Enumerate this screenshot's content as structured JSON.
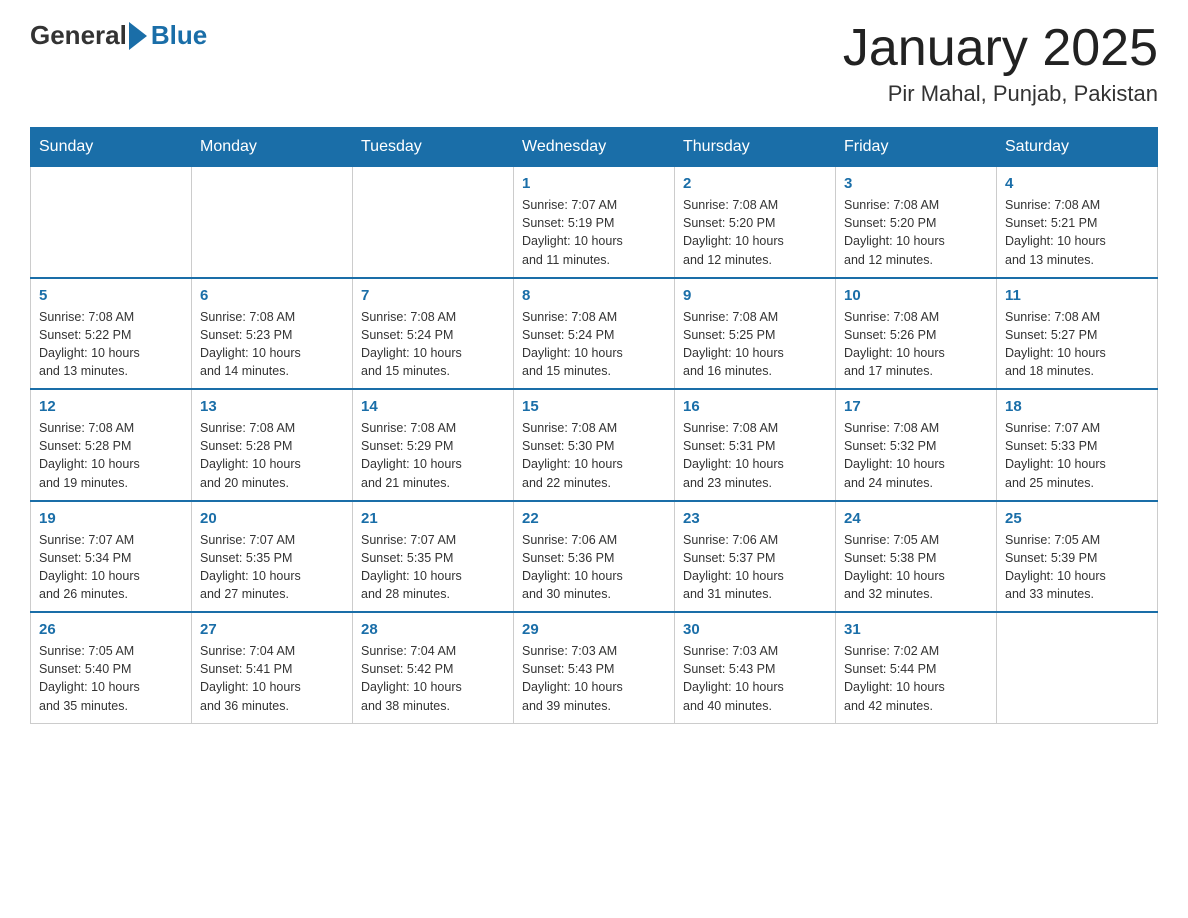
{
  "header": {
    "logo_general": "General",
    "logo_blue": "Blue",
    "title": "January 2025",
    "location": "Pir Mahal, Punjab, Pakistan"
  },
  "days_of_week": [
    "Sunday",
    "Monday",
    "Tuesday",
    "Wednesday",
    "Thursday",
    "Friday",
    "Saturday"
  ],
  "weeks": [
    {
      "days": [
        {
          "num": "",
          "info": ""
        },
        {
          "num": "",
          "info": ""
        },
        {
          "num": "",
          "info": ""
        },
        {
          "num": "1",
          "info": "Sunrise: 7:07 AM\nSunset: 5:19 PM\nDaylight: 10 hours\nand 11 minutes."
        },
        {
          "num": "2",
          "info": "Sunrise: 7:08 AM\nSunset: 5:20 PM\nDaylight: 10 hours\nand 12 minutes."
        },
        {
          "num": "3",
          "info": "Sunrise: 7:08 AM\nSunset: 5:20 PM\nDaylight: 10 hours\nand 12 minutes."
        },
        {
          "num": "4",
          "info": "Sunrise: 7:08 AM\nSunset: 5:21 PM\nDaylight: 10 hours\nand 13 minutes."
        }
      ]
    },
    {
      "days": [
        {
          "num": "5",
          "info": "Sunrise: 7:08 AM\nSunset: 5:22 PM\nDaylight: 10 hours\nand 13 minutes."
        },
        {
          "num": "6",
          "info": "Sunrise: 7:08 AM\nSunset: 5:23 PM\nDaylight: 10 hours\nand 14 minutes."
        },
        {
          "num": "7",
          "info": "Sunrise: 7:08 AM\nSunset: 5:24 PM\nDaylight: 10 hours\nand 15 minutes."
        },
        {
          "num": "8",
          "info": "Sunrise: 7:08 AM\nSunset: 5:24 PM\nDaylight: 10 hours\nand 15 minutes."
        },
        {
          "num": "9",
          "info": "Sunrise: 7:08 AM\nSunset: 5:25 PM\nDaylight: 10 hours\nand 16 minutes."
        },
        {
          "num": "10",
          "info": "Sunrise: 7:08 AM\nSunset: 5:26 PM\nDaylight: 10 hours\nand 17 minutes."
        },
        {
          "num": "11",
          "info": "Sunrise: 7:08 AM\nSunset: 5:27 PM\nDaylight: 10 hours\nand 18 minutes."
        }
      ]
    },
    {
      "days": [
        {
          "num": "12",
          "info": "Sunrise: 7:08 AM\nSunset: 5:28 PM\nDaylight: 10 hours\nand 19 minutes."
        },
        {
          "num": "13",
          "info": "Sunrise: 7:08 AM\nSunset: 5:28 PM\nDaylight: 10 hours\nand 20 minutes."
        },
        {
          "num": "14",
          "info": "Sunrise: 7:08 AM\nSunset: 5:29 PM\nDaylight: 10 hours\nand 21 minutes."
        },
        {
          "num": "15",
          "info": "Sunrise: 7:08 AM\nSunset: 5:30 PM\nDaylight: 10 hours\nand 22 minutes."
        },
        {
          "num": "16",
          "info": "Sunrise: 7:08 AM\nSunset: 5:31 PM\nDaylight: 10 hours\nand 23 minutes."
        },
        {
          "num": "17",
          "info": "Sunrise: 7:08 AM\nSunset: 5:32 PM\nDaylight: 10 hours\nand 24 minutes."
        },
        {
          "num": "18",
          "info": "Sunrise: 7:07 AM\nSunset: 5:33 PM\nDaylight: 10 hours\nand 25 minutes."
        }
      ]
    },
    {
      "days": [
        {
          "num": "19",
          "info": "Sunrise: 7:07 AM\nSunset: 5:34 PM\nDaylight: 10 hours\nand 26 minutes."
        },
        {
          "num": "20",
          "info": "Sunrise: 7:07 AM\nSunset: 5:35 PM\nDaylight: 10 hours\nand 27 minutes."
        },
        {
          "num": "21",
          "info": "Sunrise: 7:07 AM\nSunset: 5:35 PM\nDaylight: 10 hours\nand 28 minutes."
        },
        {
          "num": "22",
          "info": "Sunrise: 7:06 AM\nSunset: 5:36 PM\nDaylight: 10 hours\nand 30 minutes."
        },
        {
          "num": "23",
          "info": "Sunrise: 7:06 AM\nSunset: 5:37 PM\nDaylight: 10 hours\nand 31 minutes."
        },
        {
          "num": "24",
          "info": "Sunrise: 7:05 AM\nSunset: 5:38 PM\nDaylight: 10 hours\nand 32 minutes."
        },
        {
          "num": "25",
          "info": "Sunrise: 7:05 AM\nSunset: 5:39 PM\nDaylight: 10 hours\nand 33 minutes."
        }
      ]
    },
    {
      "days": [
        {
          "num": "26",
          "info": "Sunrise: 7:05 AM\nSunset: 5:40 PM\nDaylight: 10 hours\nand 35 minutes."
        },
        {
          "num": "27",
          "info": "Sunrise: 7:04 AM\nSunset: 5:41 PM\nDaylight: 10 hours\nand 36 minutes."
        },
        {
          "num": "28",
          "info": "Sunrise: 7:04 AM\nSunset: 5:42 PM\nDaylight: 10 hours\nand 38 minutes."
        },
        {
          "num": "29",
          "info": "Sunrise: 7:03 AM\nSunset: 5:43 PM\nDaylight: 10 hours\nand 39 minutes."
        },
        {
          "num": "30",
          "info": "Sunrise: 7:03 AM\nSunset: 5:43 PM\nDaylight: 10 hours\nand 40 minutes."
        },
        {
          "num": "31",
          "info": "Sunrise: 7:02 AM\nSunset: 5:44 PM\nDaylight: 10 hours\nand 42 minutes."
        },
        {
          "num": "",
          "info": ""
        }
      ]
    }
  ]
}
